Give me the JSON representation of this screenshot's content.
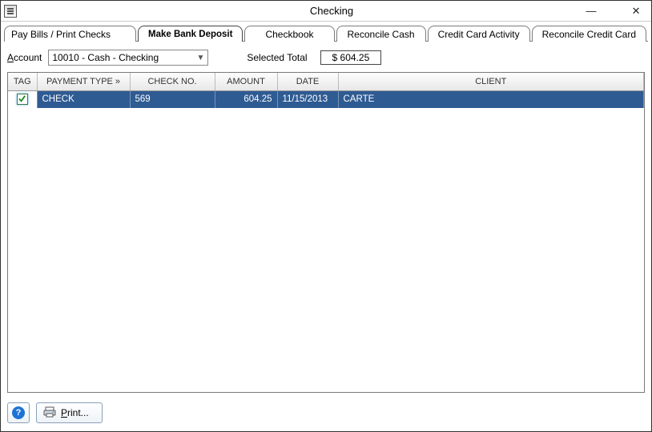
{
  "window": {
    "title": "Checking"
  },
  "tabs": [
    {
      "label": "Pay Bills / Print Checks"
    },
    {
      "label": "Make Bank Deposit",
      "selected": true
    },
    {
      "label": "Checkbook"
    },
    {
      "label": "Reconcile Cash"
    },
    {
      "label": "Credit Card Activity"
    },
    {
      "label": "Reconcile Credit Card"
    }
  ],
  "account": {
    "label_prefix": "A",
    "label_rest": "ccount",
    "value": "10010 - Cash - Checking"
  },
  "selected_total": {
    "label": "Selected Total",
    "value": "$ 604.25"
  },
  "grid": {
    "headers": {
      "tag": "TAG",
      "payment_type": "PAYMENT TYPE »",
      "check_no": "CHECK NO.",
      "amount": "AMOUNT",
      "date": "DATE",
      "client": "CLIENT"
    },
    "rows": [
      {
        "tag_checked": true,
        "payment_type": "CHECK",
        "check_no": "569",
        "amount": "604.25",
        "date": "11/15/2013",
        "client": "CARTE"
      }
    ]
  },
  "footer": {
    "print_u": "P",
    "print_rest": "rint..."
  }
}
